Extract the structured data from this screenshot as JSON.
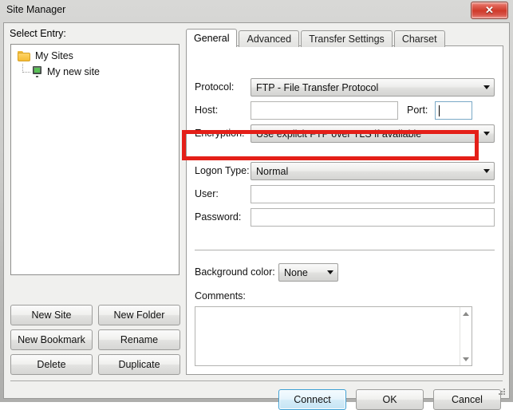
{
  "window": {
    "title": "Site Manager",
    "close_label": "✕"
  },
  "left_pane": {
    "select_entry_label": "Select Entry:",
    "tree": [
      {
        "label": "My Sites",
        "icon": "folder-icon",
        "level": 0
      },
      {
        "label": "My new site",
        "icon": "server-icon",
        "level": 1
      }
    ],
    "buttons": [
      {
        "id": "new-site",
        "label": "New Site"
      },
      {
        "id": "new-folder",
        "label": "New Folder"
      },
      {
        "id": "new-bookmark",
        "label": "New Bookmark"
      },
      {
        "id": "rename",
        "label": "Rename"
      },
      {
        "id": "delete",
        "label": "Delete"
      },
      {
        "id": "duplicate",
        "label": "Duplicate"
      }
    ]
  },
  "tabs": [
    {
      "label": "General",
      "active": true
    },
    {
      "label": "Advanced",
      "active": false
    },
    {
      "label": "Transfer Settings",
      "active": false
    },
    {
      "label": "Charset",
      "active": false
    }
  ],
  "general_tab": {
    "protocol": {
      "label": "Protocol:",
      "value": "FTP - File Transfer Protocol"
    },
    "host": {
      "label": "Host:",
      "value": "",
      "placeholder": ""
    },
    "port": {
      "label": "Port:",
      "value": "",
      "placeholder": "",
      "focused": true
    },
    "encryption": {
      "label": "Encryption:",
      "value": "Use explicit FTP over TLS if available"
    },
    "logon_type": {
      "label": "Logon Type:",
      "value": "Normal",
      "highlighted": true
    },
    "user": {
      "label": "User:",
      "value": "",
      "placeholder": ""
    },
    "password": {
      "label": "Password:",
      "value": "",
      "placeholder": ""
    },
    "background_color": {
      "label": "Background color:",
      "value": "None"
    },
    "comments": {
      "label": "Comments:",
      "value": "",
      "placeholder": ""
    }
  },
  "footer": {
    "connect_label": "Connect",
    "ok_label": "OK",
    "cancel_label": "Cancel"
  },
  "colors": {
    "highlight": "#e41f18",
    "close_button": "#cf3b2b",
    "default_focus": "#3c9fd4",
    "folder": "#f6bc35",
    "server_screen": "#59c156"
  }
}
